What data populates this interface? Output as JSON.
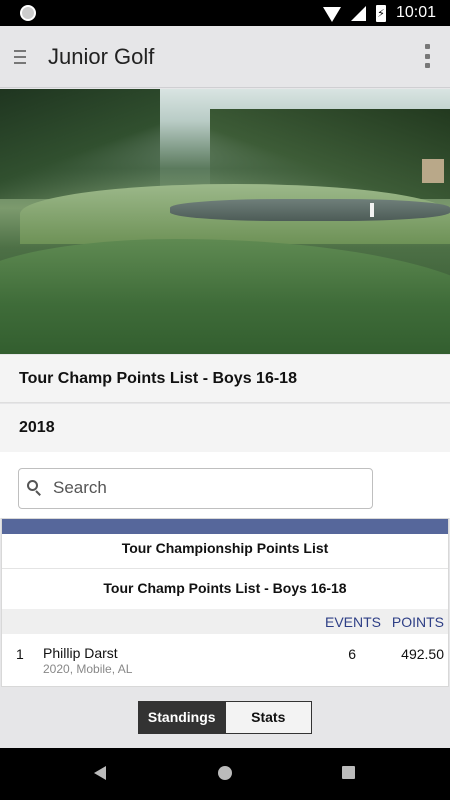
{
  "status_bar": {
    "time": "10:01",
    "battery_glyph": "⚡"
  },
  "app_bar": {
    "title": "Junior Golf"
  },
  "header": {
    "list_title": "Tour Champ Points List - Boys 16-18",
    "year": "2018"
  },
  "search": {
    "placeholder": "Search",
    "value": ""
  },
  "table": {
    "band_color": "#56679b",
    "title": "Tour Championship Points List",
    "subtitle": "Tour Champ Points List - Boys 16-18",
    "columns": {
      "events": "EVENTS",
      "points": "POINTS"
    },
    "rows": [
      {
        "rank": "1",
        "name": "Phillip Darst",
        "meta": "2020, Mobile, AL",
        "events": "6",
        "points": "492.50"
      }
    ]
  },
  "tabs": [
    {
      "label": "Standings",
      "active": true
    },
    {
      "label": "Stats",
      "active": false
    }
  ]
}
